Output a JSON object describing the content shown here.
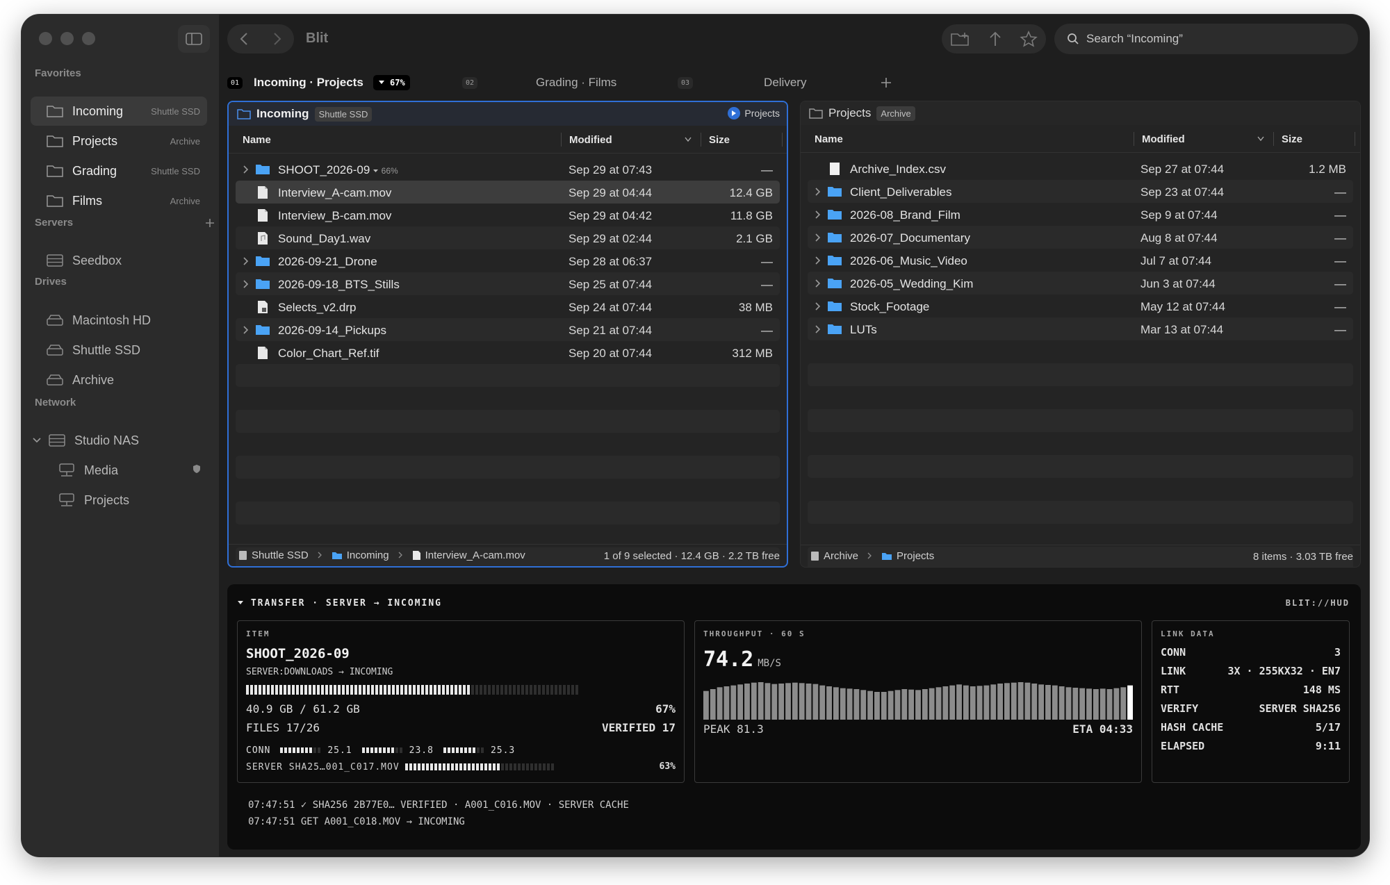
{
  "app": {
    "title": "Blit"
  },
  "sidebar": {
    "favorites_title": "Favorites",
    "favorites": [
      {
        "label": "Incoming",
        "volume": "Shuttle SSD"
      },
      {
        "label": "Projects",
        "volume": "Archive"
      },
      {
        "label": "Grading",
        "volume": "Shuttle SSD"
      },
      {
        "label": "Films",
        "volume": "Archive"
      }
    ],
    "servers_title": "Servers",
    "servers": [
      {
        "label": "Seedbox"
      }
    ],
    "drives_title": "Drives",
    "drives": [
      {
        "label": "Macintosh HD"
      },
      {
        "label": "Shuttle SSD"
      },
      {
        "label": "Archive"
      }
    ],
    "network_title": "Network",
    "network": {
      "host": "Studio NAS",
      "shares": [
        {
          "label": "Media"
        },
        {
          "label": "Projects"
        }
      ]
    }
  },
  "search": {
    "placeholder": "Search “Incoming”"
  },
  "tabs": [
    {
      "num": "01",
      "label": "Incoming · Projects",
      "progress": "67%"
    },
    {
      "num": "02",
      "label": "Grading · Films"
    },
    {
      "num": "03",
      "label": "Delivery"
    }
  ],
  "left_pane": {
    "title": "Incoming",
    "volume": "Shuttle SSD",
    "linked": "Projects",
    "cols": {
      "name": "Name",
      "modified": "Modified",
      "size": "Size"
    },
    "rows": [
      {
        "name": "SHOOT_2026-09",
        "meta": "66%",
        "modified": "Sep 29 at 07:43",
        "size": "—",
        "kind": "folder",
        "expandable": true
      },
      {
        "name": "Interview_A-cam.mov",
        "modified": "Sep 29 at 04:44",
        "size": "12.4 GB",
        "kind": "file",
        "selected": true
      },
      {
        "name": "Interview_B-cam.mov",
        "modified": "Sep 29 at 04:42",
        "size": "11.8 GB",
        "kind": "file"
      },
      {
        "name": "Sound_Day1.wav",
        "modified": "Sep 29 at 02:44",
        "size": "2.1 GB",
        "kind": "audio"
      },
      {
        "name": "2026-09-21_Drone",
        "modified": "Sep 28 at 06:37",
        "size": "—",
        "kind": "folder",
        "expandable": true
      },
      {
        "name": "2026-09-18_BTS_Stills",
        "modified": "Sep 25 at 07:44",
        "size": "—",
        "kind": "folder",
        "expandable": true
      },
      {
        "name": "Selects_v2.drp",
        "modified": "Sep 24 at 07:44",
        "size": "38 MB",
        "kind": "doc"
      },
      {
        "name": "2026-09-14_Pickups",
        "modified": "Sep 21 at 07:44",
        "size": "—",
        "kind": "folder",
        "expandable": true
      },
      {
        "name": "Color_Chart_Ref.tif",
        "modified": "Sep 20 at 07:44",
        "size": "312 MB",
        "kind": "file"
      }
    ],
    "footer": {
      "crumbs": [
        "Shuttle SSD",
        "Incoming",
        "Interview_A-cam.mov"
      ],
      "status": "1 of 9 selected · 12.4 GB · 2.2 TB free"
    }
  },
  "right_pane": {
    "title": "Projects",
    "volume": "Archive",
    "cols": {
      "name": "Name",
      "modified": "Modified",
      "size": "Size"
    },
    "rows": [
      {
        "name": "Archive_Index.csv",
        "modified": "Sep 27 at 07:44",
        "size": "1.2 MB",
        "kind": "white"
      },
      {
        "name": "Client_Deliverables",
        "modified": "Sep 23 at 07:44",
        "size": "—",
        "kind": "folder",
        "expandable": true
      },
      {
        "name": "2026-08_Brand_Film",
        "modified": "Sep 9 at 07:44",
        "size": "—",
        "kind": "folder",
        "expandable": true
      },
      {
        "name": "2026-07_Documentary",
        "modified": "Aug 8 at 07:44",
        "size": "—",
        "kind": "folder",
        "expandable": true
      },
      {
        "name": "2026-06_Music_Video",
        "modified": "Jul 7 at 07:44",
        "size": "—",
        "kind": "folder",
        "expandable": true
      },
      {
        "name": "2026-05_Wedding_Kim",
        "modified": "Jun 3 at 07:44",
        "size": "—",
        "kind": "folder",
        "expandable": true
      },
      {
        "name": "Stock_Footage",
        "modified": "May 12 at 07:44",
        "size": "—",
        "kind": "folder",
        "expandable": true
      },
      {
        "name": "LUTs",
        "modified": "Mar 13 at 07:44",
        "size": "—",
        "kind": "folder",
        "expandable": true
      }
    ],
    "footer": {
      "crumbs": [
        "Archive",
        "Projects"
      ],
      "status": "8 items · 3.03 TB free"
    }
  },
  "hud": {
    "title": "TRANSFER · SERVER → INCOMING",
    "brand": "BLIT://HUD",
    "item": {
      "label": "ITEM",
      "name": "SHOOT_2026-09",
      "route": "SERVER:DOWNLOADS → INCOMING",
      "progress": 0.67,
      "bytes": "40.9 GB / 61.2 GB",
      "pct": "67%",
      "files": "FILES 17/26",
      "verified": "VERIFIED 17",
      "conn_label": "CONN",
      "conns": [
        {
          "value": "25.1",
          "fill": 0.75
        },
        {
          "value": "23.8",
          "fill": 0.75
        },
        {
          "value": "25.3",
          "fill": 0.75
        }
      ],
      "current_file": "SERVER SHA25…001_C017.MOV",
      "current_progress": 0.63,
      "current_pct": "63%"
    },
    "throughput": {
      "label": "THROUGHPUT · 60 S",
      "value": "74.2",
      "unit": "MB/S",
      "peak": "PEAK 81.3",
      "eta": "ETA 04:33",
      "samples": [
        62,
        66,
        70,
        72,
        74,
        76,
        78,
        80,
        81,
        79,
        77,
        78,
        79,
        80,
        79,
        78,
        77,
        74,
        72,
        70,
        68,
        67,
        66,
        64,
        62,
        60,
        60,
        62,
        64,
        66,
        65,
        64,
        66,
        68,
        70,
        72,
        74,
        76,
        74,
        72,
        73,
        74,
        76,
        78,
        79,
        80,
        81,
        80,
        78,
        76,
        75,
        74,
        72,
        70,
        69,
        68,
        67,
        66,
        67,
        66,
        68,
        70,
        74
      ]
    },
    "link": {
      "label": "LINK DATA",
      "rows": [
        {
          "k": "CONN",
          "v": "3"
        },
        {
          "k": "LINK",
          "v": "3X · 255KX32 · EN7"
        },
        {
          "k": "RTT",
          "v": "148 MS"
        },
        {
          "k": "VERIFY",
          "v": "SERVER SHA256"
        },
        {
          "k": "HASH CACHE",
          "v": "5/17"
        },
        {
          "k": "ELAPSED",
          "v": "9:11"
        }
      ]
    },
    "log": [
      "07:47:51 ✓ SHA256 2B77E0… VERIFIED · A001_C016.MOV · SERVER CACHE",
      "07:47:51 GET A001_C018.MOV → INCOMING"
    ]
  }
}
